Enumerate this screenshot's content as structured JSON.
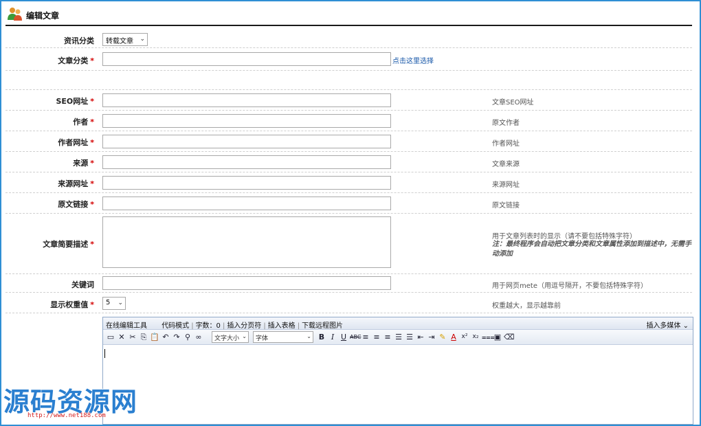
{
  "header": {
    "title": "编辑文章"
  },
  "fields": {
    "info_category": {
      "label": "资讯分类",
      "value": "转载文章"
    },
    "article_category": {
      "label": "文章分类",
      "required": "*",
      "link": "点击这里选择"
    },
    "seo_url": {
      "label": "SEO网址",
      "required": "*",
      "hint": "文章SEO网址"
    },
    "author": {
      "label": "作者",
      "required": "*",
      "hint": "原文作者"
    },
    "author_url": {
      "label": "作者网址",
      "required": "*",
      "hint": "作者网址"
    },
    "source": {
      "label": "来源",
      "required": "*",
      "hint": "文章来源"
    },
    "source_url": {
      "label": "来源网址",
      "required": "*",
      "hint": "来源网址"
    },
    "original_link": {
      "label": "原文链接",
      "required": "*",
      "hint": "原文链接"
    },
    "summary": {
      "label": "文章简要描述",
      "required": "*",
      "hint": "用于文章列表时的显示（请不要包括特殊字符）",
      "note": "注：最终程序会自动把文章分类和文章属性添加到描述中，无需手动添加"
    },
    "keywords": {
      "label": "关键词",
      "hint": "用于网页mete（用逗号隔开，不要包括特殊字符）"
    },
    "weight": {
      "label": "显示权重值",
      "required": "*",
      "value": "5",
      "hint": "权重越大，显示越靠前"
    }
  },
  "editor": {
    "tabs": [
      "在线编辑工具",
      "代码模式",
      "字数：0",
      "插入分页符",
      "插入表格",
      "下载远程图片"
    ],
    "insert_media": "插入多媒体",
    "font_size_select": "文字大小",
    "font_family_select": "字体"
  },
  "watermark": {
    "text": "源码资源网",
    "url": "http://www.net188.com"
  },
  "colors": {
    "accent": "#2f8fd4",
    "required": "#d40000",
    "link": "#1656a8"
  }
}
